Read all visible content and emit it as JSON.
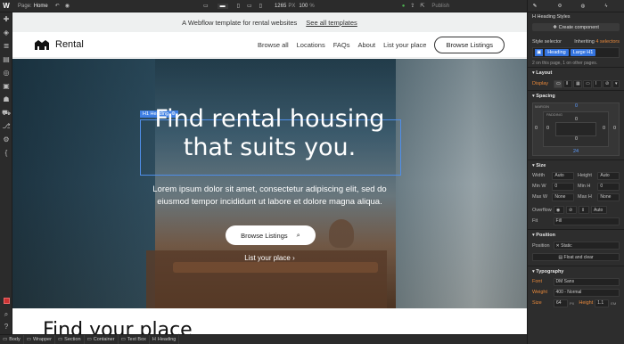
{
  "topbar": {
    "page_label": "Page:",
    "page_name": "Home",
    "width": "1265",
    "width_unit": "PX",
    "zoom": "100",
    "zoom_unit": "%",
    "publish": "Publish"
  },
  "left_icons": [
    "plus-icon",
    "box-icon",
    "layers-icon",
    "pages-icon",
    "cms-icon",
    "assets-icon",
    "users-icon",
    "ecommerce-icon",
    "logic-icon",
    "settings-icon",
    "braces-icon"
  ],
  "announcement": {
    "text": "A Webflow template for rental websites",
    "link": "See all templates"
  },
  "nav": {
    "logo": "Rental",
    "links": [
      "Browse all",
      "Locations",
      "FAQs",
      "About",
      "List your place"
    ],
    "button": "Browse Listings"
  },
  "hero": {
    "heading_line1": "Find rental housing",
    "heading_line2": "that suits you.",
    "tag": "H1 Heading",
    "paragraph_line1": "Lorem ipsum dolor sit amet, consectetur adipiscing elit, sed do",
    "paragraph_line2": "eiusmod tempor incididunt ut labore et dolore magna aliqua.",
    "button": "Browse Listings",
    "link": "List your place",
    "arrow": "›"
  },
  "below_heading": "Find your place",
  "breadcrumb": [
    "Body",
    "Wrapper",
    "Section",
    "Container",
    "Text Box",
    "Heading"
  ],
  "panel": {
    "styles_title": "Heading Styles",
    "create_component": "Create component",
    "selector_label": "Style selector",
    "inheriting": "Inheriting",
    "inheriting_count": "4 selectors",
    "chips": [
      "Heading",
      "Large H1"
    ],
    "on_page": "2 on this page, 1 on other pages.",
    "layout": "Layout",
    "display": "Display",
    "spacing": "Spacing",
    "margin": "MARGIN",
    "padding": "PADDING",
    "m_top": "0",
    "m_left": "0",
    "m_right": "0",
    "m_bottom": "24",
    "p_top": "0",
    "p_left": "0",
    "p_right": "0",
    "p_bottom": "0",
    "size": "Size",
    "width": "Width",
    "height": "Height",
    "auto": "Auto",
    "min_w": "Min W",
    "min_h": "Min H",
    "max_w": "Max W",
    "max_h": "Max H",
    "none": "None",
    "zero": "0",
    "px": "PX",
    "overflow": "Overflow",
    "fit": "Fit",
    "fill": "Fill",
    "position": "Position",
    "position_value": "Static",
    "float_clear": "Float and clear",
    "typography": "Typography",
    "font": "Font",
    "font_value": "DM Sans",
    "weight": "Weight",
    "weight_value": "400 - Normal",
    "size_label": "Size",
    "size_value": "64",
    "line_height": "Height",
    "lh_value": "1.1",
    "em": "EM"
  },
  "colors": {
    "accent": "#3f7fe4",
    "orange": "#e8883a"
  }
}
